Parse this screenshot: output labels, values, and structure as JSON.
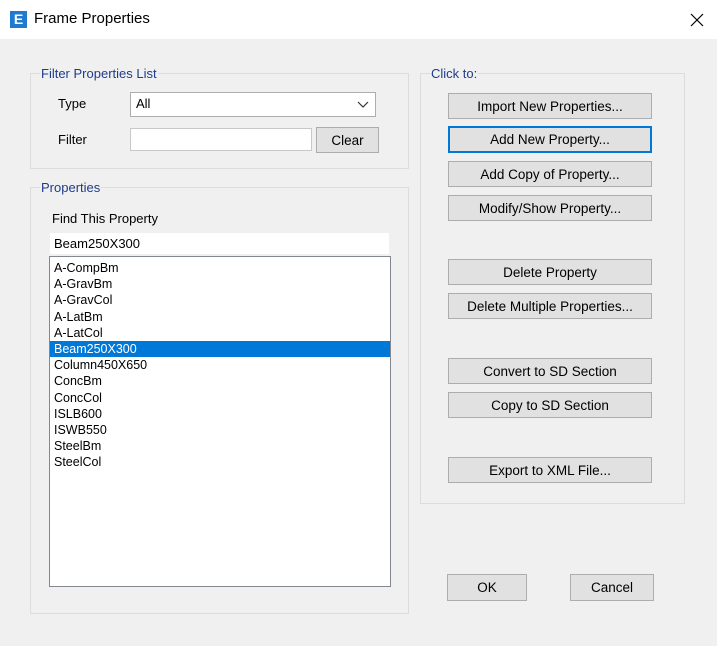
{
  "window": {
    "title": "Frame Properties",
    "app_icon_letter": "E"
  },
  "filter": {
    "group_label": "Filter Properties List",
    "type_label": "Type",
    "type_value": "All",
    "filter_label": "Filter",
    "filter_value": "",
    "clear_label": "Clear"
  },
  "properties": {
    "group_label": "Properties",
    "find_label": "Find This Property",
    "find_value": "Beam250X300",
    "items": [
      "A-CompBm",
      "A-GravBm",
      "A-GravCol",
      "A-LatBm",
      "A-LatCol",
      "Beam250X300",
      "Column450X650",
      "ConcBm",
      "ConcCol",
      "ISLB600",
      "ISWB550",
      "SteelBm",
      "SteelCol"
    ],
    "selected": "Beam250X300"
  },
  "click_to": {
    "group_label": "Click to:",
    "import_label": "Import New Properties...",
    "add_new_label": "Add New Property...",
    "add_copy_label": "Add Copy of Property...",
    "modify_label": "Modify/Show Property...",
    "delete_label": "Delete Property",
    "delete_multiple_label": "Delete Multiple Properties...",
    "convert_sd_label": "Convert to SD Section",
    "copy_sd_label": "Copy to SD Section",
    "export_xml_label": "Export to XML File..."
  },
  "footer": {
    "ok_label": "OK",
    "cancel_label": "Cancel"
  }
}
